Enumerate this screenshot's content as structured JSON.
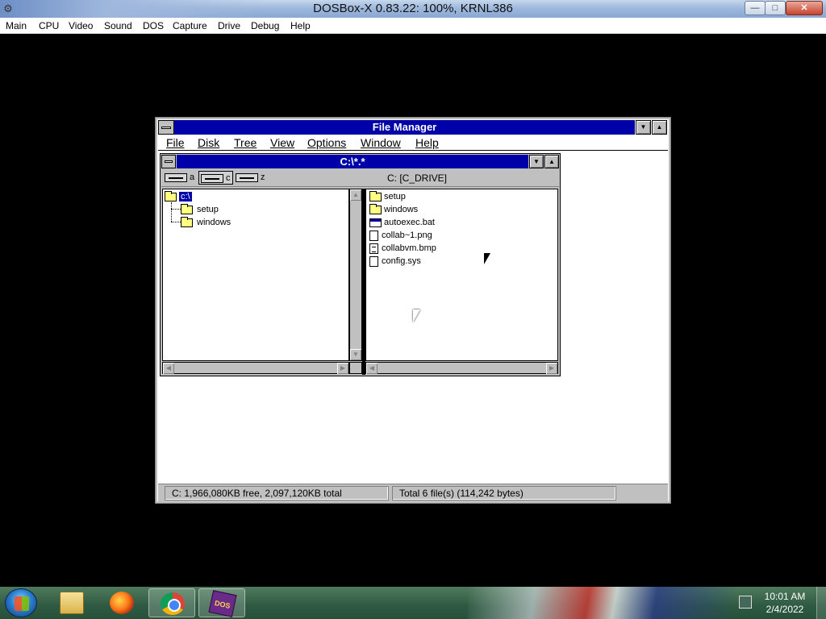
{
  "host": {
    "title": "DOSBox-X 0.83.22: 100%, KRNL386",
    "menu": [
      "Main",
      "CPU",
      "Video",
      "Sound",
      "DOS",
      "Capture",
      "Drive",
      "Debug",
      "Help"
    ],
    "controls": {
      "minimize": "—",
      "maximize": "□",
      "close": "✕"
    }
  },
  "file_manager": {
    "title": "File Manager",
    "menu": [
      "File",
      "Disk",
      "Tree",
      "View",
      "Options",
      "Window",
      "Help"
    ],
    "child": {
      "title": "C:\\*.*",
      "drives": [
        "a",
        "c",
        "z"
      ],
      "selected_drive": "c",
      "drive_label": "C: [C_DRIVE]",
      "tree": {
        "root": "c:\\",
        "children": [
          "setup",
          "windows"
        ]
      },
      "files": [
        {
          "name": "setup",
          "type": "folder"
        },
        {
          "name": "windows",
          "type": "folder"
        },
        {
          "name": "autoexec.bat",
          "type": "app"
        },
        {
          "name": "collab~1.png",
          "type": "doc"
        },
        {
          "name": "collabvm.bmp",
          "type": "doc"
        },
        {
          "name": "config.sys",
          "type": "text"
        }
      ]
    },
    "status": {
      "free": "C: 1,966,080KB free,  2,097,120KB total",
      "total": "Total 6 file(s) (114,242 bytes)"
    }
  },
  "taskbar": {
    "apps": [
      "explorer",
      "firefox",
      "chrome",
      "dosbox"
    ],
    "dosbox_label": "DOS BOX",
    "clock_time": "10:01 AM",
    "clock_date": "2/4/2022"
  },
  "colors": {
    "title_active": "#0000a8",
    "win31_face": "#c0c0c0",
    "taskbar": "#2f5a42"
  }
}
